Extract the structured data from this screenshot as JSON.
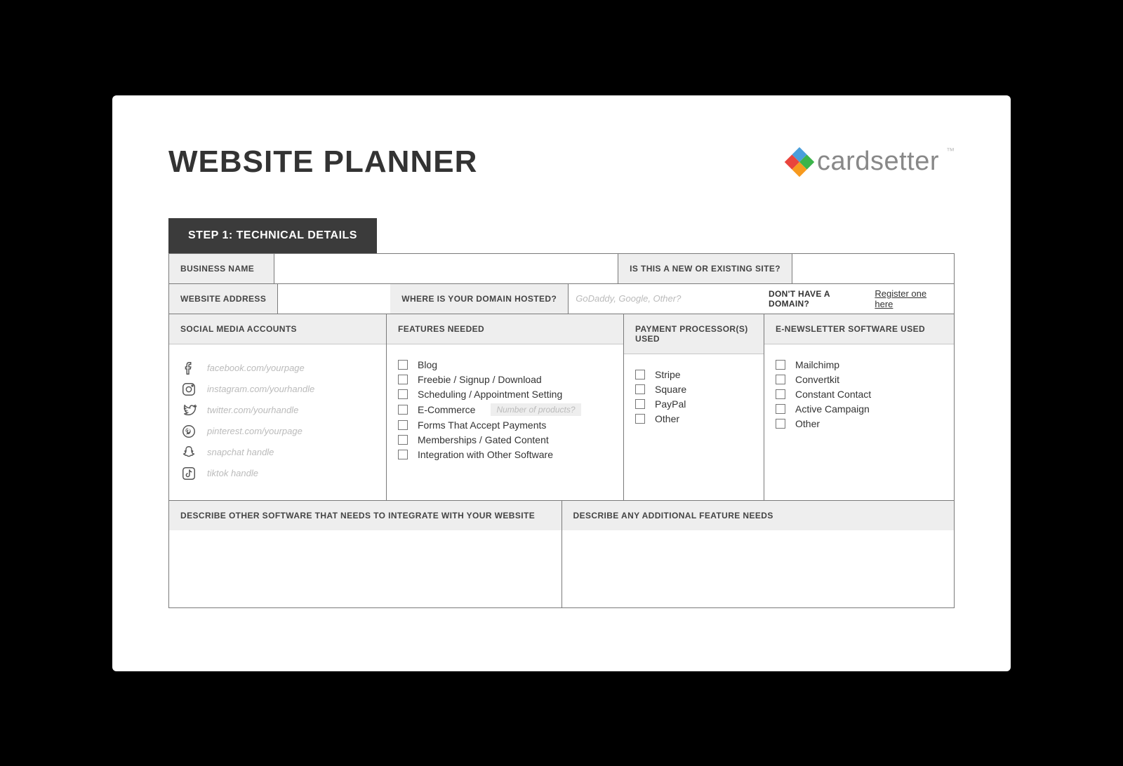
{
  "header": {
    "title": "WEBSITE PLANNER",
    "brand": "cardsetter",
    "tm": "™"
  },
  "step": {
    "label": "STEP 1: TECHNICAL DETAILS"
  },
  "row1": {
    "business_name_label": "BUSINESS NAME",
    "new_or_existing_label": "IS THIS A NEW OR EXISTING SITE?"
  },
  "row2": {
    "website_address_label": "WEBSITE ADDRESS",
    "domain_hosted_label": "WHERE IS YOUR DOMAIN HOSTED?",
    "domain_placeholder": "GoDaddy, Google, Other?",
    "no_domain_text": "DON'T HAVE A DOMAIN?",
    "register_link": "Register one here"
  },
  "columns": {
    "social_header": "SOCIAL MEDIA ACCOUNTS",
    "features_header": "FEATURES NEEDED",
    "payment_header": "PAYMENT PROCESSOR(S) USED",
    "newsletter_header": "E-NEWSLETTER SOFTWARE USED"
  },
  "social": [
    {
      "name": "facebook",
      "placeholder": "facebook.com/yourpage"
    },
    {
      "name": "instagram",
      "placeholder": "instagram.com/yourhandle"
    },
    {
      "name": "twitter",
      "placeholder": "twitter.com/yourhandle"
    },
    {
      "name": "pinterest",
      "placeholder": "pinterest.com/yourpage"
    },
    {
      "name": "snapchat",
      "placeholder": "snapchat handle"
    },
    {
      "name": "tiktok",
      "placeholder": "tiktok handle"
    }
  ],
  "features": [
    "Blog",
    "Freebie / Signup / Download",
    "Scheduling / Appointment Setting",
    "E-Commerce",
    "Forms That Accept Payments",
    "Memberships / Gated Content",
    "Integration with Other Software"
  ],
  "ecommerce_placeholder": "Number of products?",
  "payment": [
    "Stripe",
    "Square",
    "PayPal",
    "Other"
  ],
  "newsletter": [
    "Mailchimp",
    "Convertkit",
    "Constant Contact",
    "Active Campaign",
    "Other"
  ],
  "bottom": {
    "integrate_label": "DESCRIBE OTHER SOFTWARE THAT NEEDS TO INTEGRATE WITH YOUR WEBSITE",
    "additional_label": "DESCRIBE ANY ADDITIONAL FEATURE NEEDS"
  }
}
